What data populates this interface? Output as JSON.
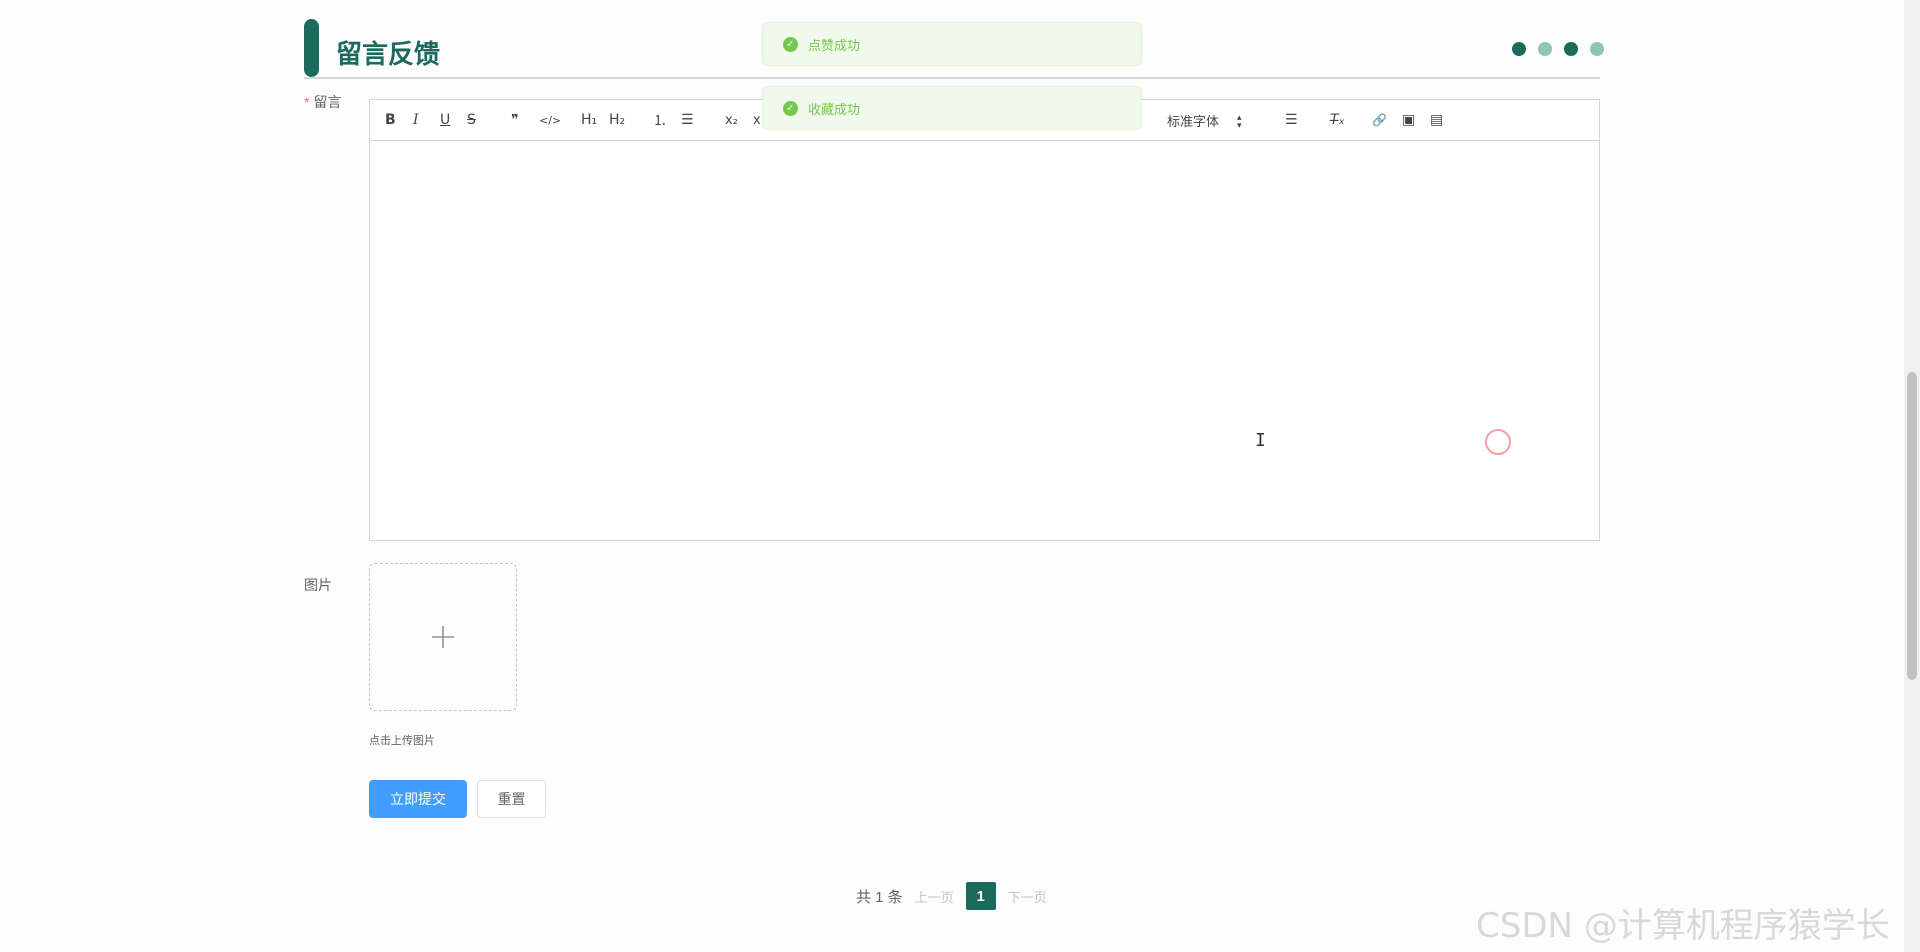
{
  "header": {
    "title": "留言反馈",
    "accent_color": "#1a6b5c",
    "dots": [
      "#1a6b5c",
      "#8fc5b8",
      "#1a6b5c",
      "#8fc5b8"
    ]
  },
  "form": {
    "message_label": "留言",
    "required_mark": "*",
    "image_label": "图片",
    "upload_hint": "点击上传图片",
    "upload_icon": "plus-icon"
  },
  "editor": {
    "toolbar": {
      "bold": "B",
      "italic": "I",
      "underline": "U",
      "strike": "S",
      "quote": "❞",
      "code": "</>",
      "h1": "H₁",
      "h2": "H₂",
      "ordered_list": "⒈",
      "bullet_list": "☰",
      "subscript": "x₂",
      "superscript": "x",
      "font": "标准字体",
      "align": "☰",
      "clear_format": "T̶ₓ",
      "link": "🔗",
      "image": "▣",
      "video": "▤"
    }
  },
  "buttons": {
    "submit": "立即提交",
    "reset": "重置"
  },
  "pagination": {
    "total": "共 1 条",
    "prev": "上一页",
    "current": "1",
    "next": "下一页"
  },
  "toasts": [
    {
      "text": "点赞成功",
      "icon": "check-circle-icon"
    },
    {
      "text": "收藏成功",
      "icon": "check-circle-icon"
    }
  ],
  "watermark": "CSDN @计算机程序猿学长"
}
